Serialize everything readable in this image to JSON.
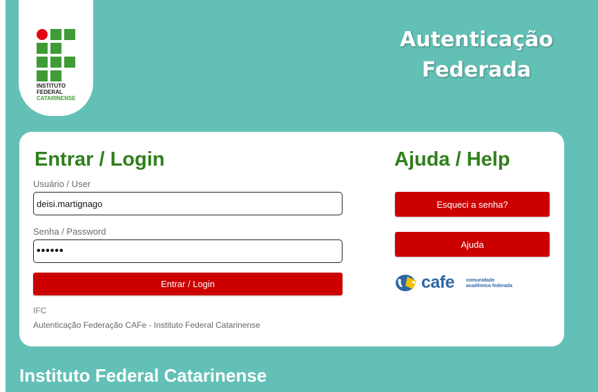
{
  "header": {
    "logo": {
      "icon": "ifc-logo-icon",
      "line1": "INSTITUTO",
      "line2": "FEDERAL",
      "line3": "CATARINENSE",
      "colors": {
        "green": "#3f9b35",
        "red": "#e30613"
      }
    },
    "title_line1": "Autenticação",
    "title_line2": "Federada"
  },
  "login": {
    "heading": "Entrar / Login",
    "user_label": "Usuário / User",
    "user_value": "deisi.martignago",
    "password_label": "Senha / Password",
    "password_value": "••••••",
    "submit_label": "Entrar / Login"
  },
  "help": {
    "heading": "Ajuda / Help",
    "forgot_label": "Esqueci a senha?",
    "help_label": "Ajuda",
    "cafe_logo": {
      "icon": "cafe-cup-icon",
      "word": "cafe",
      "tagline1": "comunidade",
      "tagline2": "acadêmica federada"
    }
  },
  "footer": {
    "org_short": "IFC",
    "org_full": "Autenticação Federação CAFe - Instituto Federal Catarinense"
  },
  "bottom_title": "Instituto Federal Catarinense",
  "colors": {
    "background": "#63c0b6",
    "accent_red": "#cc0000",
    "heading_green": "#2f7f1b"
  }
}
